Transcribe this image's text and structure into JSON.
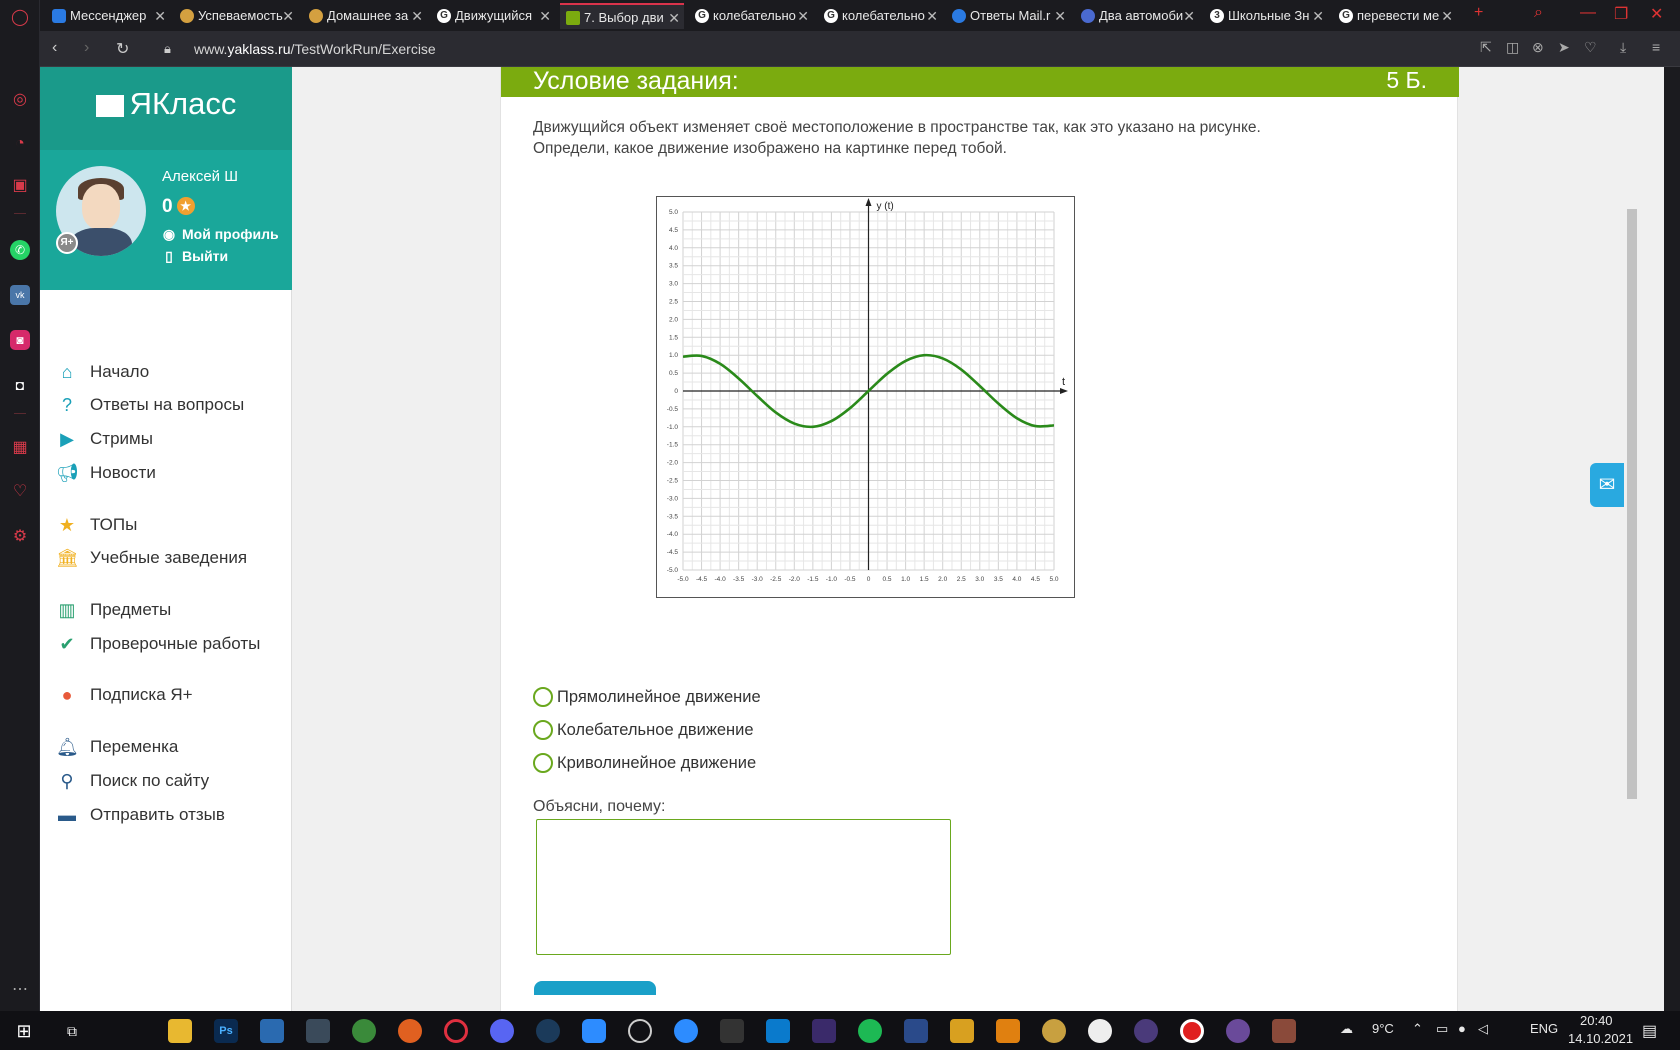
{
  "browser": {
    "tabs": [
      {
        "label": "Мессенджер",
        "icon": "messenger"
      },
      {
        "label": "Успеваемость",
        "icon": "hand"
      },
      {
        "label": "Домашнее за",
        "icon": "hand"
      },
      {
        "label": "Движущийся",
        "icon": "google"
      },
      {
        "label": "7. Выбор дви",
        "icon": "yaklass",
        "active": true
      },
      {
        "label": "колебательно",
        "icon": "google"
      },
      {
        "label": "колебательно",
        "icon": "google"
      },
      {
        "label": "Ответы Mail.r",
        "icon": "mail"
      },
      {
        "label": "Два автомоби",
        "icon": "owl"
      },
      {
        "label": "Школьные Зн",
        "icon": "znanija"
      },
      {
        "label": "перевести ме",
        "icon": "google"
      }
    ],
    "url_prefix": "www.",
    "url_domain": "yaklass.ru",
    "url_path": "/TestWorkRun/Exercise"
  },
  "sidebar": {
    "logo": "ЯКласс",
    "user_name": "Алексей Ш",
    "points": "0",
    "badge": "Я+",
    "profile_link": "Мой профиль",
    "logout_link": "Выйти",
    "menu": [
      {
        "label": "Начало",
        "icon": "home-icon"
      },
      {
        "label": "Ответы на вопросы",
        "icon": "question-icon"
      },
      {
        "label": "Стримы",
        "icon": "play-icon"
      },
      {
        "label": "Новости",
        "icon": "megaphone-icon"
      },
      {
        "label": "ТОПы",
        "icon": "star-icon"
      },
      {
        "label": "Учебные заведения",
        "icon": "school-icon"
      },
      {
        "label": "Предметы",
        "icon": "books-icon"
      },
      {
        "label": "Проверочные работы",
        "icon": "check-icon"
      },
      {
        "label": "Подписка Я+",
        "icon": "ya-plus-icon"
      },
      {
        "label": "Переменка",
        "icon": "bell-icon"
      },
      {
        "label": "Поиск по сайту",
        "icon": "search-icon"
      },
      {
        "label": "Отправить отзыв",
        "icon": "feedback-icon"
      }
    ]
  },
  "task": {
    "header": "Условие задания:",
    "score": "5 Б.",
    "text_line1": "Движущийся объект изменяет своё местоположение в пространстве так, как это указано на рисунке.",
    "text_line2": "Определи, какое движение  изображено на картинке перед тобой.",
    "options": [
      "Прямолинейное движение",
      "Колебательное движение",
      "Криволинейное движение"
    ],
    "explain_label": "Объясни, почему:",
    "textarea_value": ""
  },
  "chart_data": {
    "type": "line",
    "xlabel": "t",
    "ylabel": "y (t)",
    "xlim": [
      -5.0,
      5.0
    ],
    "ylim": [
      -5.0,
      5.0
    ],
    "x_ticks": [
      "-5.0",
      "-4.5",
      "-4.0",
      "-3.5",
      "-3.0",
      "-2.5",
      "-2.0",
      "-1.5",
      "-1.0",
      "-0.5",
      "0",
      "0.5",
      "1.0",
      "1.5",
      "2.0",
      "2.5",
      "3.0",
      "3.5",
      "4.0",
      "4.5",
      "5.0"
    ],
    "y_ticks": [
      "5.0",
      "4.5",
      "4.0",
      "3.5",
      "3.0",
      "2.5",
      "2.0",
      "1.5",
      "1.0",
      "0.5",
      "0",
      "-0.5",
      "-1.0",
      "-1.5",
      "-2.0",
      "-2.5",
      "-3.0",
      "-3.5",
      "-4.0",
      "-4.5",
      "-5.0"
    ],
    "grid": true,
    "series": [
      {
        "x": [
          -5.0,
          -4.5,
          -4.0,
          -3.5,
          -3.0,
          -2.5,
          -2.0,
          -1.5,
          -1.0,
          -0.5,
          0,
          0.5,
          1.0,
          1.5,
          2.0,
          2.5,
          3.0,
          3.5,
          4.0,
          4.5,
          5.0
        ],
        "y": [
          0.96,
          0.98,
          0.76,
          0.35,
          -0.14,
          -0.6,
          -0.91,
          -1.0,
          -0.84,
          -0.48,
          0,
          0.48,
          0.84,
          1.0,
          0.91,
          0.6,
          0.14,
          -0.35,
          -0.76,
          -0.98,
          -0.96
        ],
        "color": "#2a8a1a"
      }
    ]
  },
  "taskbar": {
    "weather": "9°C",
    "lang": "ENG",
    "time": "20:40",
    "date": "14.10.2021"
  }
}
